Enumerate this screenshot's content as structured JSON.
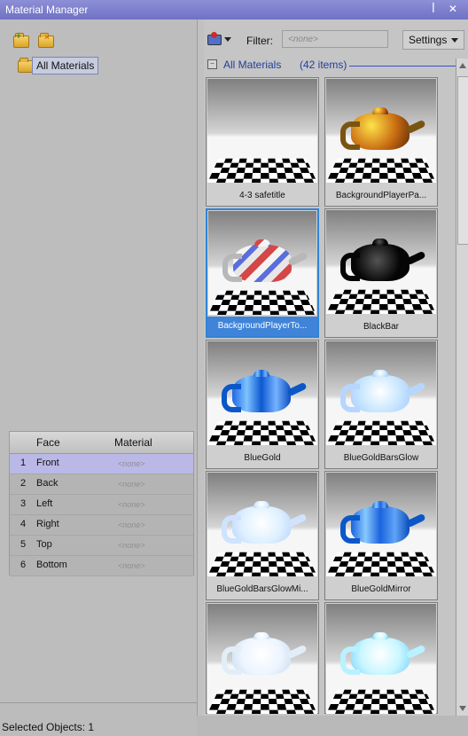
{
  "window": {
    "title": "Material Manager",
    "controls": "ꟾ ✕"
  },
  "left": {
    "tree": {
      "label": "All Materials"
    },
    "table": {
      "headers": [
        "Face",
        "Material"
      ],
      "rows": [
        {
          "num": "1",
          "face": "Front",
          "material": "<none>"
        },
        {
          "num": "2",
          "face": "Back",
          "material": "<none>"
        },
        {
          "num": "3",
          "face": "Left",
          "material": "<none>"
        },
        {
          "num": "4",
          "face": "Right",
          "material": "<none>"
        },
        {
          "num": "5",
          "face": "Top",
          "material": "<none>"
        },
        {
          "num": "6",
          "face": "Bottom",
          "material": "<none>"
        }
      ]
    },
    "status": "Selected Objects: 1"
  },
  "right": {
    "filter_label": "Filter:",
    "filter_placeholder": "<none>",
    "settings_label": "Settings",
    "group_label": "All Materials",
    "group_count": "(42 items)",
    "materials": [
      "4-3 safetitle",
      "BackgroundPlayerPa...",
      "BackgroundPlayerTo...",
      "BlackBar",
      "BlueGold",
      "BlueGoldBarsGlow",
      "BlueGoldBarsGlowMi...",
      "BlueGoldMirror",
      "",
      ""
    ]
  },
  "colors": {
    "accent": "#3f84d8",
    "title": "#6f72c4",
    "group": "#203f9d"
  }
}
